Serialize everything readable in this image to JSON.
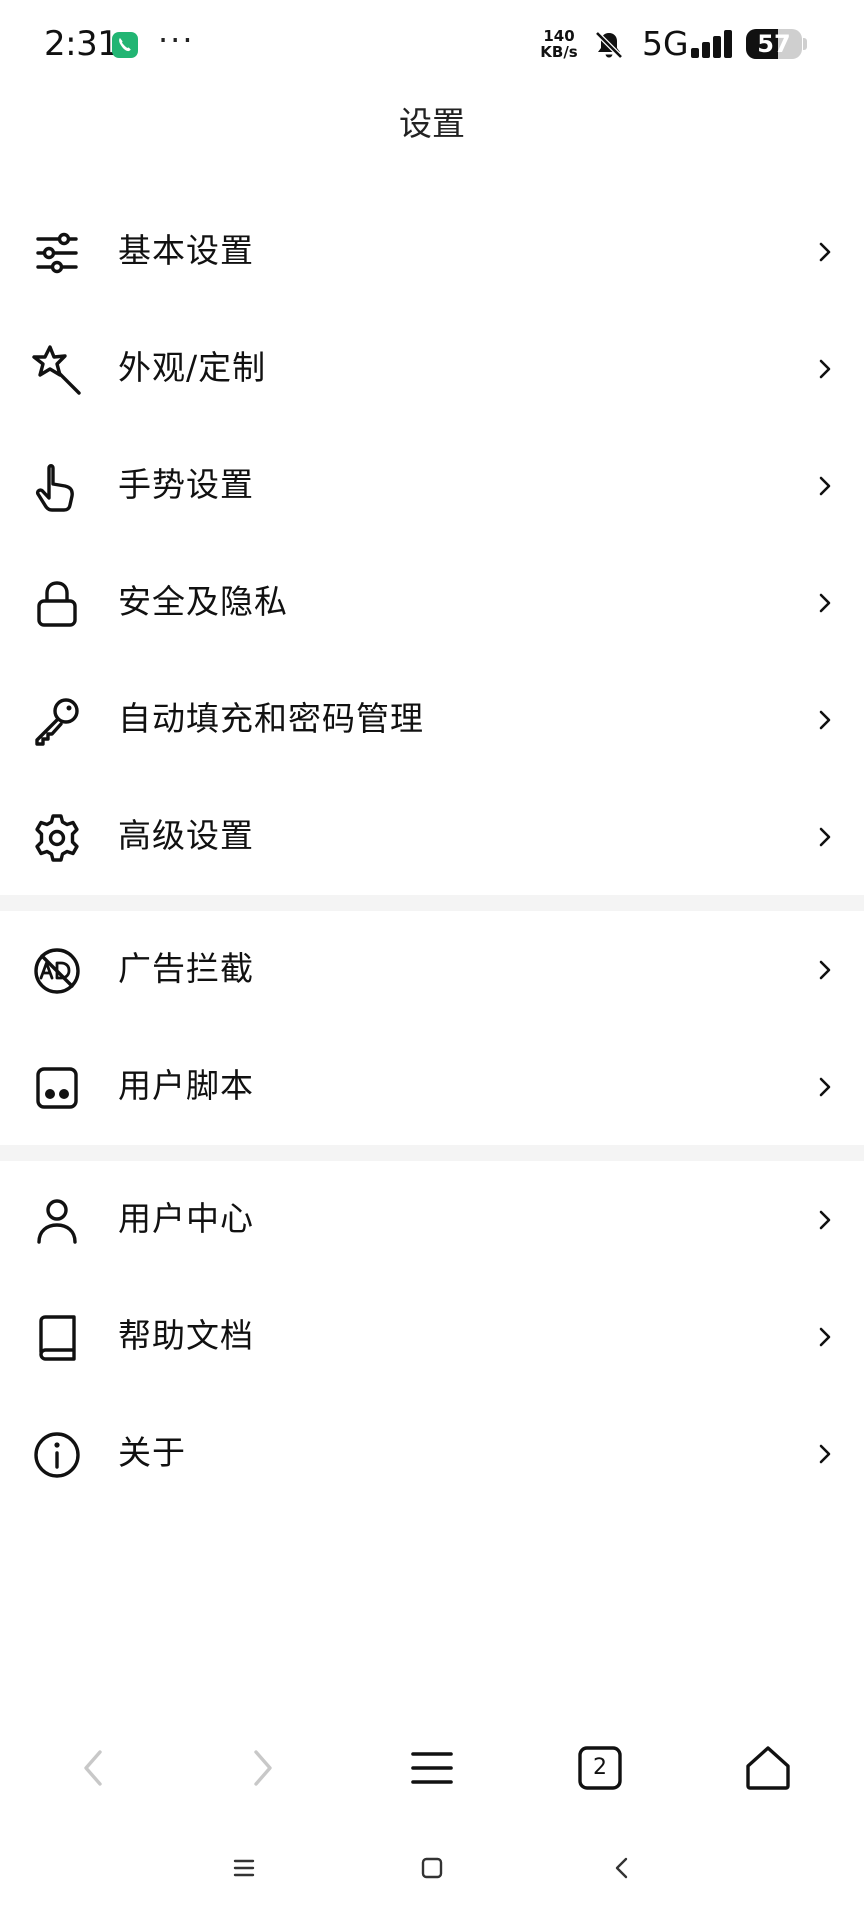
{
  "status_bar": {
    "time": "2:31",
    "more": "···",
    "net_speed_value": "140",
    "net_speed_unit": "KB/s",
    "network_type": "5G",
    "battery_level": "57",
    "battery_fraction": 0.57,
    "icons": [
      "phone-call-icon",
      "bell-off-icon",
      "signal-icon",
      "battery-icon"
    ]
  },
  "header": {
    "title": "设置"
  },
  "settings_groups": [
    {
      "items": [
        {
          "label": "基本设置",
          "icon": "sliders-icon"
        },
        {
          "label": "外观/定制",
          "icon": "magic-wand-icon"
        },
        {
          "label": "手势设置",
          "icon": "hand-pointer-icon"
        },
        {
          "label": "安全及隐私",
          "icon": "lock-icon"
        },
        {
          "label": "自动填充和密码管理",
          "icon": "key-icon"
        },
        {
          "label": "高级设置",
          "icon": "gear-icon"
        }
      ]
    },
    {
      "items": [
        {
          "label": "广告拦截",
          "icon": "ad-block-icon"
        },
        {
          "label": "用户脚本",
          "icon": "user-script-icon"
        }
      ]
    },
    {
      "items": [
        {
          "label": "用户中心",
          "icon": "user-icon"
        },
        {
          "label": "帮助文档",
          "icon": "book-icon"
        },
        {
          "label": "关于",
          "icon": "info-icon"
        }
      ]
    }
  ],
  "browser_toolbar": {
    "tab_count": "2",
    "buttons": [
      "back-arrow-icon",
      "forward-arrow-icon",
      "menu-icon",
      "tabs-icon",
      "home-icon"
    ]
  },
  "system_nav": {
    "buttons": [
      "recents-icon",
      "home-square-icon",
      "back-icon"
    ]
  },
  "colors": {
    "text": "#111111",
    "divider": "#f4f4f4",
    "disabled": "#c8c8c8",
    "call_green": "#22b573"
  }
}
